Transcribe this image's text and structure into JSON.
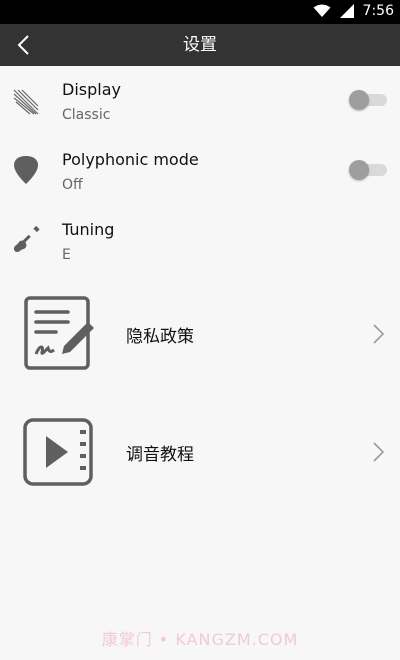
{
  "status_bar": {
    "time": "7:56",
    "icons": [
      "wifi-icon",
      "signal-icon"
    ]
  },
  "toolbar": {
    "title": "设置",
    "back_icon": "chevron-left-icon"
  },
  "settings": [
    {
      "title": "Display",
      "subtitle": "Classic",
      "icon": "display-lines-icon",
      "toggle_on": false
    },
    {
      "title": "Polyphonic mode",
      "subtitle": "Off",
      "icon": "guitar-pick-icon",
      "toggle_on": false
    },
    {
      "title": "Tuning",
      "subtitle": "E",
      "icon": "guitar-icon"
    }
  ],
  "links": [
    {
      "label": "隐私政策",
      "icon": "document-sign-icon"
    },
    {
      "label": "调音教程",
      "icon": "video-play-icon"
    }
  ],
  "watermark": "康掌门 • KANGZM.COM",
  "colors": {
    "toolbar": "#333333",
    "background": "#f7f7f7",
    "icon_gray": "#5f5f5f",
    "toggle_thumb": "#9e9e9e",
    "toggle_track": "#d9d9d9"
  }
}
